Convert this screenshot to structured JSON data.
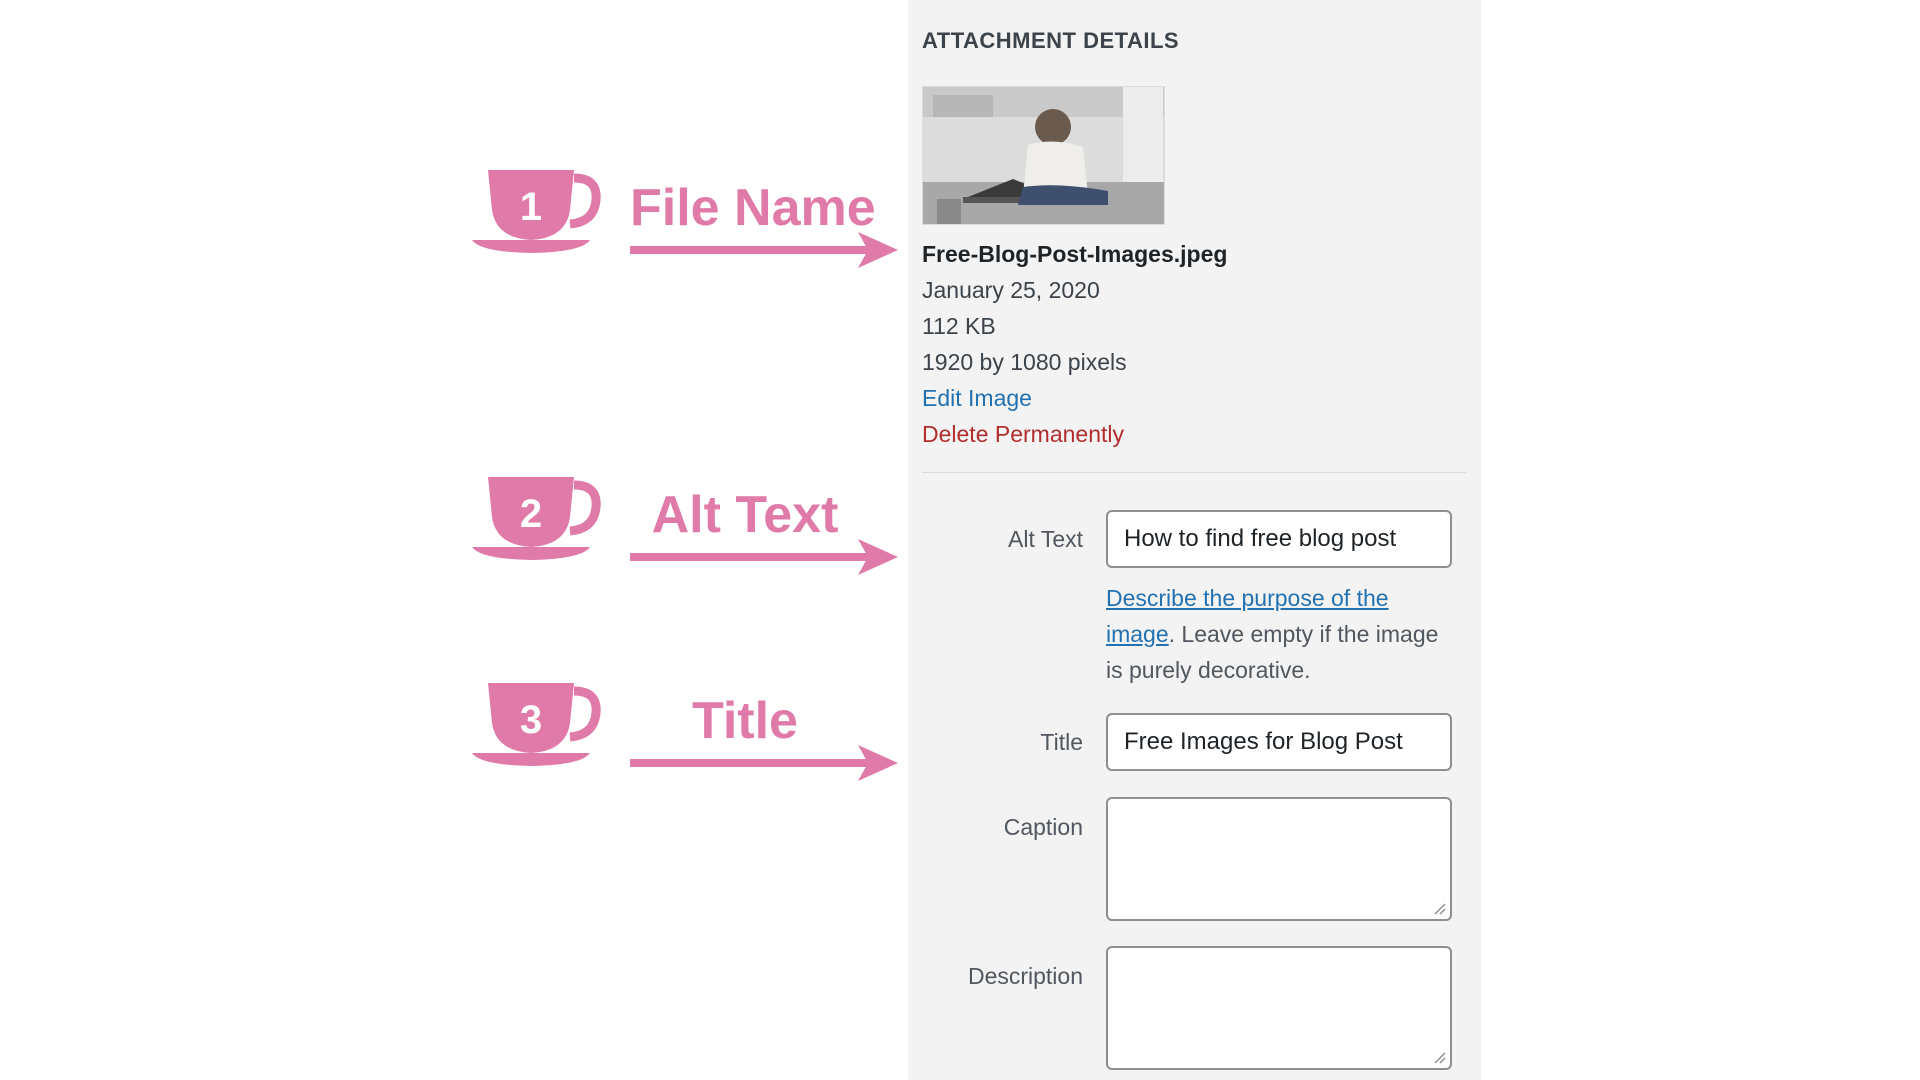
{
  "callouts": [
    {
      "number": "1",
      "label": "File Name"
    },
    {
      "number": "2",
      "label": "Alt Text"
    },
    {
      "number": "3",
      "label": "Title"
    }
  ],
  "colors": {
    "callout_pink": "#e07aa8",
    "panel_bg": "#f3f3f3",
    "link_blue": "#2271b1",
    "delete_red": "#b32d2e"
  },
  "panel": {
    "heading": "ATTACHMENT DETAILS",
    "file": {
      "name": "Free-Blog-Post-Images.jpeg",
      "date": "January 25, 2020",
      "size": "112 KB",
      "dimensions": "1920 by 1080 pixels",
      "edit_label": "Edit Image",
      "delete_label": "Delete Permanently"
    },
    "fields": {
      "alt_text": {
        "label": "Alt Text",
        "value": "How to find free blog post"
      },
      "alt_help": {
        "link_text": "Describe the purpose of the image",
        "rest_text": ". Leave empty if the image is purely decorative."
      },
      "title": {
        "label": "Title",
        "value": "Free Images for Blog Post"
      },
      "caption": {
        "label": "Caption",
        "value": ""
      },
      "description": {
        "label": "Description",
        "value": ""
      }
    }
  }
}
